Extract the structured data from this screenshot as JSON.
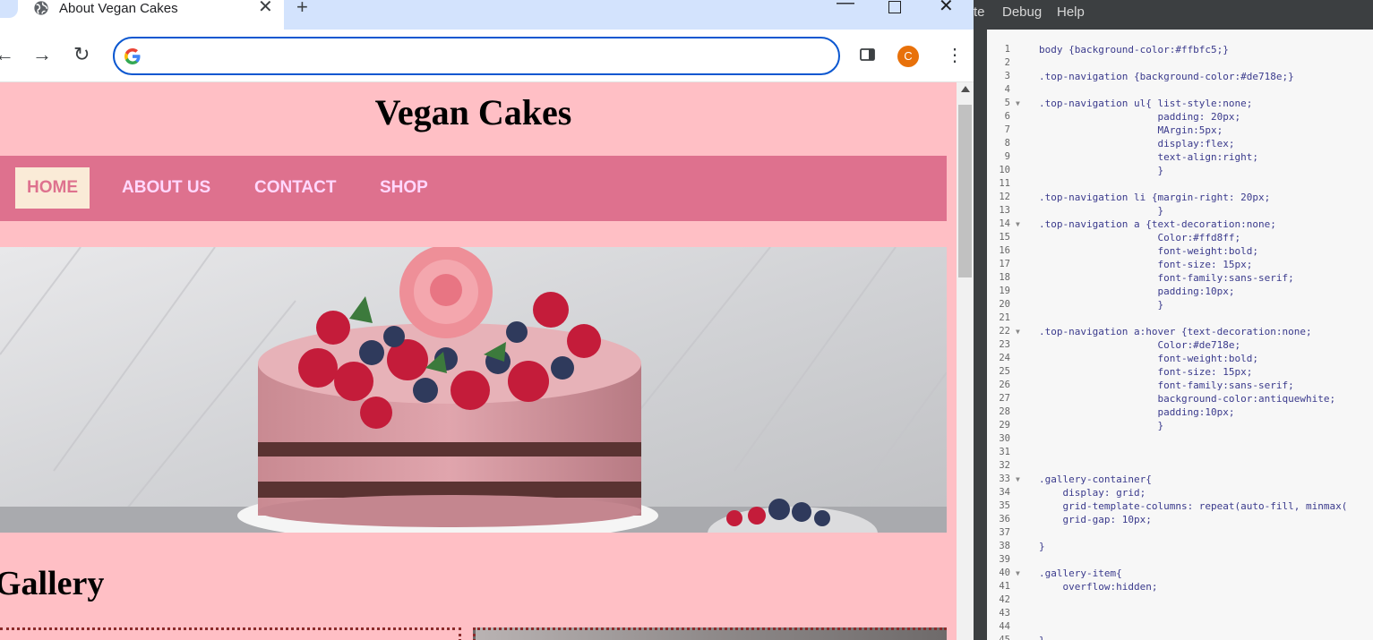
{
  "browser": {
    "tab": {
      "title": "About Vegan Cakes",
      "close_glyph": "✕",
      "favicon": "globe-icon"
    },
    "new_tab_glyph": "+",
    "window_controls": {
      "minimize": "—",
      "close": "✕"
    },
    "nav": {
      "back": "←",
      "forward": "→",
      "reload": "↻"
    },
    "address": {
      "value": "",
      "placeholder": ""
    },
    "profile_initial": "C",
    "menu_glyph": "⋮",
    "accent": "#0b57d0"
  },
  "page": {
    "title": "Vegan Cakes",
    "nav": [
      "HOME",
      "ABOUT US",
      "CONTACT",
      "SHOP"
    ],
    "hero_alt": "cake",
    "gallery_heading": "Gallery",
    "colors": {
      "background": "#ffbfc5",
      "nav": "#de718e",
      "link": "#ffd8ff",
      "active_bg": "#faebd7"
    }
  },
  "editor": {
    "menu": [
      "te",
      "Debug",
      "Help"
    ],
    "lines": [
      {
        "n": "1",
        "code": "body {background-color:#ffbfc5;}"
      },
      {
        "n": "2",
        "code": ""
      },
      {
        "n": "3",
        "code": ".top-navigation {background-color:#de718e;}"
      },
      {
        "n": "4",
        "code": ""
      },
      {
        "n": "5",
        "code": ".top-navigation ul{ list-style:none;",
        "fold": "▼"
      },
      {
        "n": "6",
        "code": "                    padding: 20px;"
      },
      {
        "n": "7",
        "code": "                    MArgin:5px;"
      },
      {
        "n": "8",
        "code": "                    display:flex;"
      },
      {
        "n": "9",
        "code": "                    text-align:right;"
      },
      {
        "n": "10",
        "code": "                    }"
      },
      {
        "n": "11",
        "code": ""
      },
      {
        "n": "12",
        "code": ".top-navigation li {margin-right: 20px;"
      },
      {
        "n": "13",
        "code": "                    }"
      },
      {
        "n": "14",
        "code": ".top-navigation a {text-decoration:none;",
        "fold": "▼"
      },
      {
        "n": "15",
        "code": "                    Color:#ffd8ff;"
      },
      {
        "n": "16",
        "code": "                    font-weight:bold;"
      },
      {
        "n": "17",
        "code": "                    font-size: 15px;"
      },
      {
        "n": "18",
        "code": "                    font-family:sans-serif;"
      },
      {
        "n": "19",
        "code": "                    padding:10px;"
      },
      {
        "n": "20",
        "code": "                    }"
      },
      {
        "n": "21",
        "code": ""
      },
      {
        "n": "22",
        "code": ".top-navigation a:hover {text-decoration:none;",
        "fold": "▼"
      },
      {
        "n": "23",
        "code": "                    Color:#de718e;"
      },
      {
        "n": "24",
        "code": "                    font-weight:bold;"
      },
      {
        "n": "25",
        "code": "                    font-size: 15px;"
      },
      {
        "n": "26",
        "code": "                    font-family:sans-serif;"
      },
      {
        "n": "27",
        "code": "                    background-color:antiquewhite;"
      },
      {
        "n": "28",
        "code": "                    padding:10px;"
      },
      {
        "n": "29",
        "code": "                    }"
      },
      {
        "n": "30",
        "code": ""
      },
      {
        "n": "31",
        "code": ""
      },
      {
        "n": "32",
        "code": ""
      },
      {
        "n": "33",
        "code": ".gallery-container{",
        "fold": "▼"
      },
      {
        "n": "34",
        "code": "    display: grid;"
      },
      {
        "n": "35",
        "code": "    grid-template-columns: repeat(auto-fill, minmax("
      },
      {
        "n": "36",
        "code": "    grid-gap: 10px;"
      },
      {
        "n": "37",
        "code": ""
      },
      {
        "n": "38",
        "code": "}"
      },
      {
        "n": "39",
        "code": ""
      },
      {
        "n": "40",
        "code": ".gallery-item{",
        "fold": "▼"
      },
      {
        "n": "41",
        "code": "    overflow:hidden;"
      },
      {
        "n": "42",
        "code": ""
      },
      {
        "n": "43",
        "code": ""
      },
      {
        "n": "44",
        "code": ""
      },
      {
        "n": "45",
        "code": "}"
      }
    ]
  }
}
